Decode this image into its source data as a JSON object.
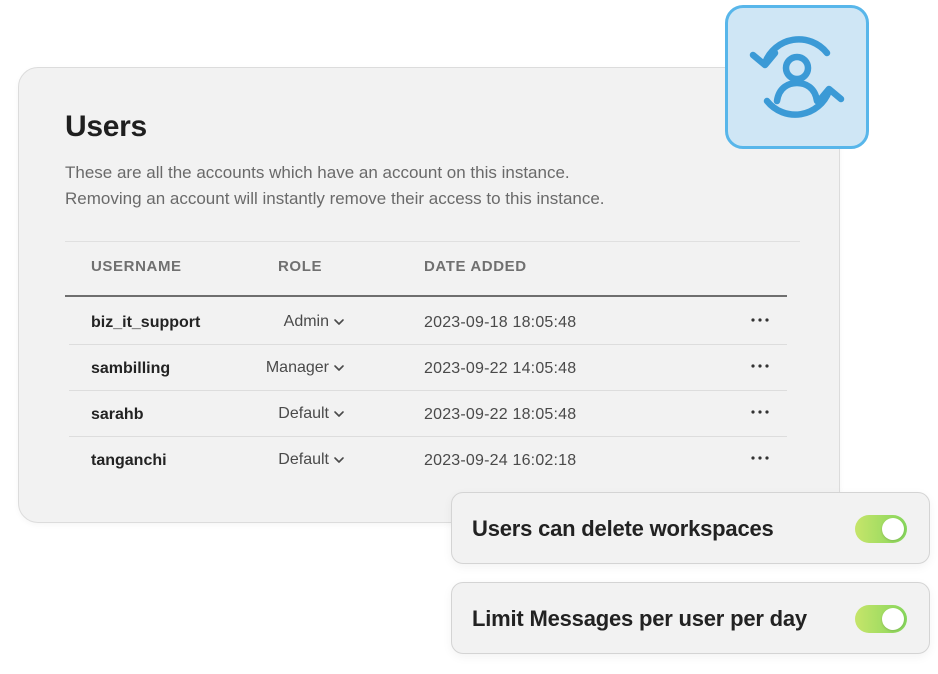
{
  "users_panel": {
    "title": "Users",
    "description_line1": "These are all the accounts which have an account on this instance.",
    "description_line2": "Removing an account will instantly remove their access to this instance.",
    "columns": {
      "username": "USERNAME",
      "role": "ROLE",
      "date_added": "DATE ADDED"
    },
    "rows": [
      {
        "username": "biz_it_support",
        "role": "Admin",
        "date_added": "2023-09-18 18:05:48"
      },
      {
        "username": "sambilling",
        "role": "Manager",
        "date_added": "2023-09-22 14:05:48"
      },
      {
        "username": "sarahb",
        "role": "Default",
        "date_added": "2023-09-22 18:05:48"
      },
      {
        "username": "tanganchi",
        "role": "Default",
        "date_added": "2023-09-24 16:02:18"
      }
    ]
  },
  "badge": {
    "icon": "user-sync-icon",
    "color": "#3b9ad6"
  },
  "settings": [
    {
      "label": "Users can delete workspaces",
      "enabled": true
    },
    {
      "label": "Limit Messages per user per day",
      "enabled": true
    }
  ],
  "colors": {
    "toggle_on": "#9bdc5e",
    "accent_blue": "#58b6ea"
  }
}
